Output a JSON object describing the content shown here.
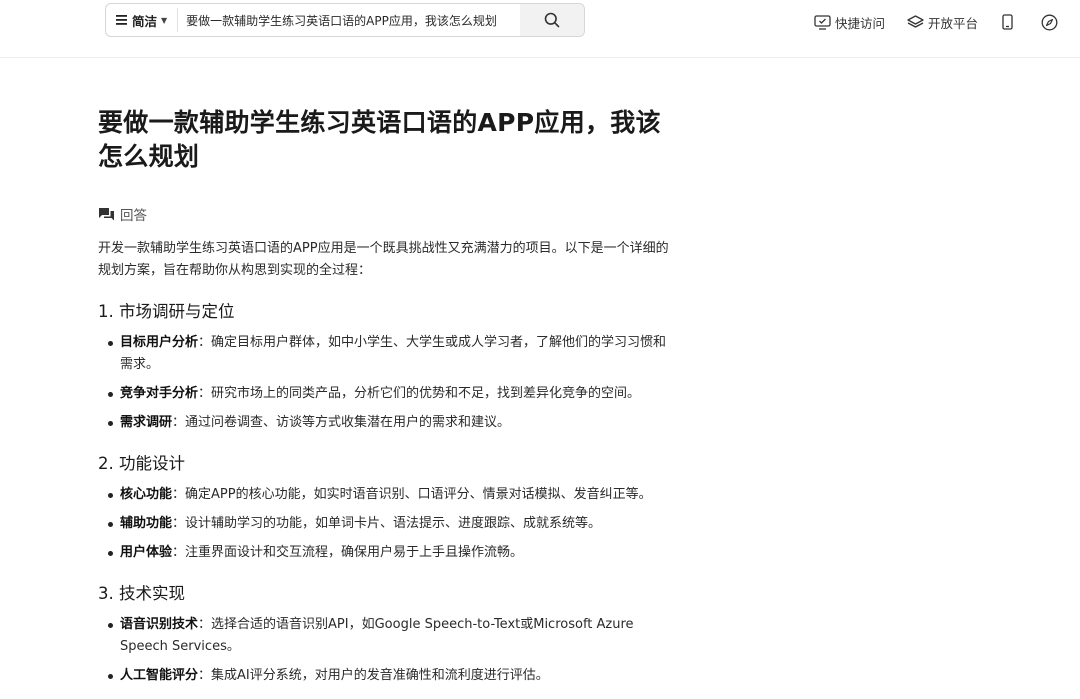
{
  "search": {
    "mode_label": "简洁",
    "query": "要做一款辅助学生练习英语口语的APP应用，我该怎么规划"
  },
  "nav": {
    "quick_access": "快捷访问",
    "open_platform": "开放平台"
  },
  "page": {
    "title": "要做一款辅助学生练习英语口语的APP应用，我该怎么规划",
    "answer_label": "回答",
    "intro": "开发一款辅助学生练习英语口语的APP应用是一个既具挑战性又充满潜力的项目。以下是一个详细的规划方案，旨在帮助你从构思到实现的全过程："
  },
  "sections": [
    {
      "heading": "1. 市场调研与定位",
      "items": [
        {
          "term": "目标用户分析",
          "sep": "：",
          "desc": "确定目标用户群体，如中小学生、大学生或成人学习者，了解他们的学习习惯和需求。"
        },
        {
          "term": "竞争对手分析",
          "sep": "：",
          "desc": "研究市场上的同类产品，分析它们的优势和不足，找到差异化竞争的空间。"
        },
        {
          "term": "需求调研",
          "sep": "：",
          "desc": "通过问卷调查、访谈等方式收集潜在用户的需求和建议。"
        }
      ]
    },
    {
      "heading": "2. 功能设计",
      "items": [
        {
          "term": "核心功能",
          "sep": "：",
          "desc": "确定APP的核心功能，如实时语音识别、口语评分、情景对话模拟、发音纠正等。"
        },
        {
          "term": "辅助功能",
          "sep": "：",
          "desc": "设计辅助学习的功能，如单词卡片、语法提示、进度跟踪、成就系统等。"
        },
        {
          "term": "用户体验",
          "sep": "：",
          "desc": "注重界面设计和交互流程，确保用户易于上手且操作流畅。"
        }
      ]
    },
    {
      "heading": "3. 技术实现",
      "items": [
        {
          "term": "语音识别技术",
          "sep": "：",
          "desc": "选择合适的语音识别API，如Google Speech-to-Text或Microsoft Azure Speech Services。"
        },
        {
          "term": "人工智能评分",
          "sep": "：",
          "desc": "集成AI评分系统，对用户的发音准确性和流利度进行评估。"
        }
      ]
    }
  ]
}
